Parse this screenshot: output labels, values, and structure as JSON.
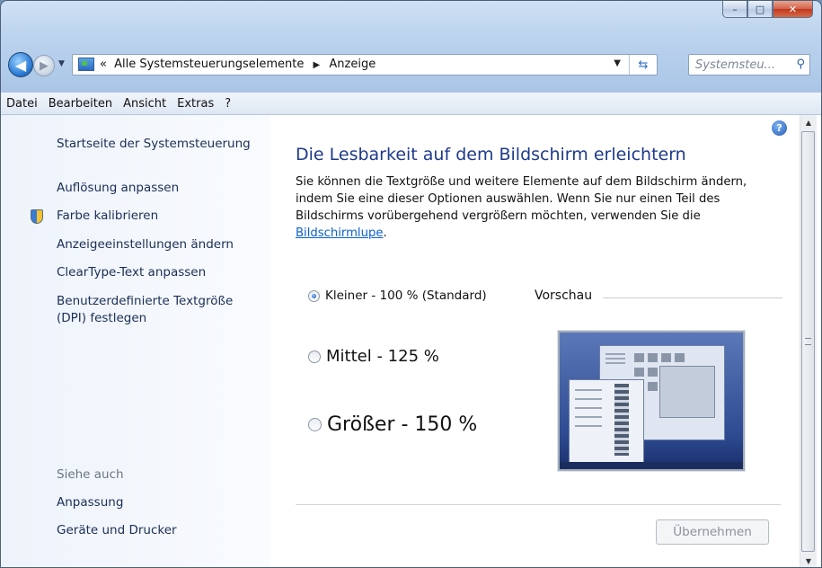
{
  "window": {
    "buttons": {
      "minimize": "–",
      "maximize": "□",
      "close": "✕"
    }
  },
  "nav": {
    "back_icon": "arrow-left-icon",
    "forward_icon": "arrow-right-icon",
    "breadcrumb_prefix": "«",
    "breadcrumb": [
      "Alle Systemsteuerungselemente",
      "Anzeige"
    ],
    "search_placeholder": "Systemsteu..."
  },
  "menu": [
    "Datei",
    "Bearbeiten",
    "Ansicht",
    "Extras",
    "?"
  ],
  "sidebar": {
    "links": [
      "Startseite der Systemsteuerung",
      "Auflösung anpassen",
      "Farbe kalibrieren",
      "Anzeigeeinstellungen ändern",
      "ClearType-Text anpassen",
      "Benutzerdefinierte Textgröße",
      "(DPI) festlegen"
    ],
    "see_also_heading": "Siehe auch",
    "see_also": [
      "Anpassung",
      "Geräte und Drucker"
    ]
  },
  "main": {
    "title": "Die Lesbarkeit auf dem Bildschirm erleichtern",
    "desc_text": "Sie können die Textgröße und weitere Elemente auf dem Bildschirm ändern, indem Sie eine dieser Optionen auswählen. Wenn Sie nur einen Teil des Bildschirms vorübergehend vergrößern möchten, verwenden Sie die ",
    "desc_link": "Bildschirmlupe",
    "desc_end": ".",
    "options": [
      {
        "label": "Kleiner - 100 % (Standard)",
        "selected": true
      },
      {
        "label": "Mittel - 125 %",
        "selected": false
      },
      {
        "label": "Größer - 150 %",
        "selected": false
      }
    ],
    "preview_label": "Vorschau",
    "apply_button": "Übernehmen"
  }
}
